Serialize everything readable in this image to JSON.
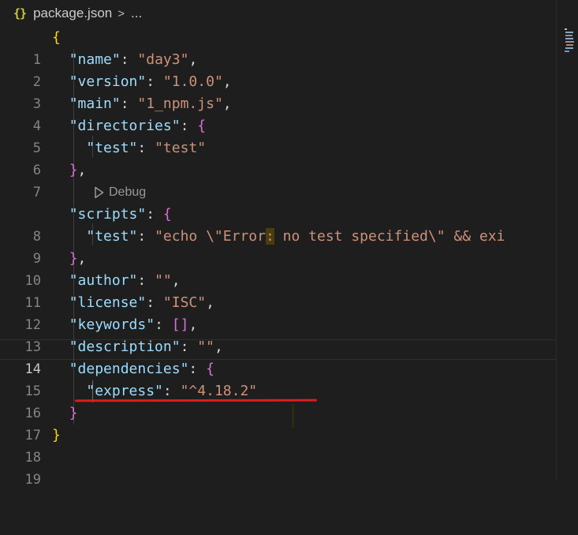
{
  "breadcrumb": {
    "icon_name": "json-braces-icon",
    "icon_text": "{}",
    "file": "package.json",
    "separator": ">",
    "rest": "..."
  },
  "editor": {
    "language": "json",
    "active_line": 14,
    "codelens_label": "Debug",
    "colors": {
      "background": "#1e1e1e",
      "key": "#9cdcfe",
      "string": "#ce9178",
      "bracket_level1": "#ffd700",
      "bracket_level2": "#da70d6",
      "annotation_underline": "#e01b1b"
    },
    "lines": [
      {
        "n": "1"
      },
      {
        "n": "2"
      },
      {
        "n": "3"
      },
      {
        "n": "4"
      },
      {
        "n": "5"
      },
      {
        "n": "6"
      },
      {
        "n": "7"
      },
      {
        "n": "8"
      },
      {
        "n": "9"
      },
      {
        "n": "10"
      },
      {
        "n": "11"
      },
      {
        "n": "12"
      },
      {
        "n": "13"
      },
      {
        "n": "14"
      },
      {
        "n": "15"
      },
      {
        "n": "16"
      },
      {
        "n": "17"
      },
      {
        "n": "18"
      },
      {
        "n": "19"
      }
    ]
  },
  "content": {
    "name": {
      "key": "\"name\"",
      "value": "\"day3\""
    },
    "version": {
      "key": "\"version\"",
      "value": "\"1.0.0\""
    },
    "main": {
      "key": "\"main\"",
      "value": "\"1_npm.js\""
    },
    "directories": {
      "key": "\"directories\""
    },
    "directories_test": {
      "key": "\"test\"",
      "value": "\"test\""
    },
    "scripts": {
      "key": "\"scripts\""
    },
    "scripts_test": {
      "key": "\"test\"",
      "value_a": "\"echo \\\"Error",
      "value_b": ":",
      "value_c": " no test specified\\\" && exi"
    },
    "author": {
      "key": "\"author\"",
      "value": "\"\""
    },
    "license": {
      "key": "\"license\"",
      "value": "\"ISC\""
    },
    "keywords": {
      "key": "\"keywords\"",
      "value": "[]"
    },
    "description": {
      "key": "\"description\"",
      "value": "\"\""
    },
    "dependencies": {
      "key": "\"dependencies\""
    },
    "express": {
      "key": "\"express\"",
      "value": "\"^4.18.2\""
    }
  }
}
